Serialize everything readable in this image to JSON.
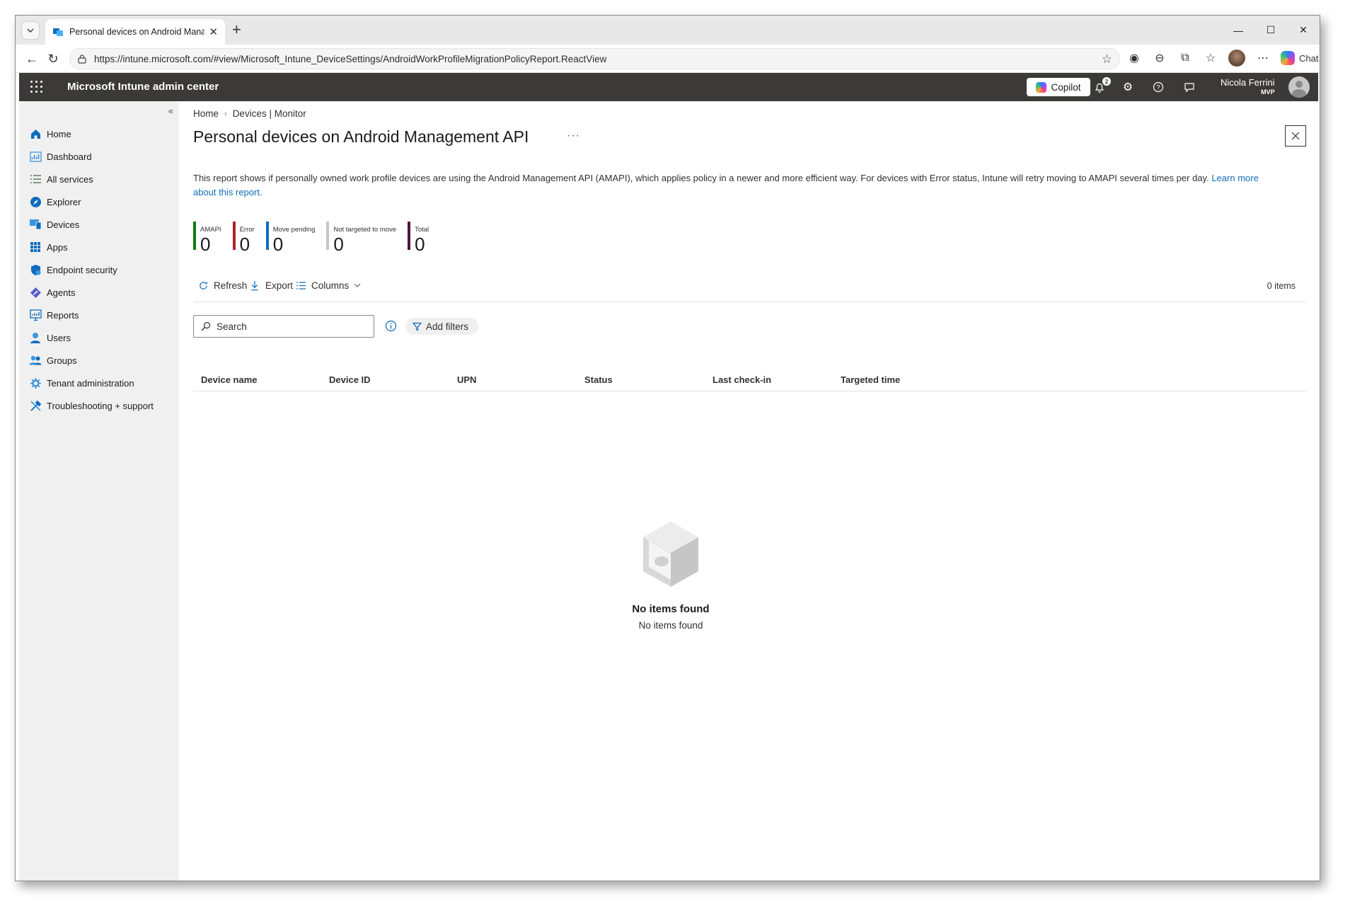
{
  "browser": {
    "tab_title": "Personal devices on Android Mana",
    "url": "https://intune.microsoft.com/#view/Microsoft_Intune_DeviceSettings/AndroidWorkProfileMigrationPolicyReport.ReactView",
    "chat_label": "Chat"
  },
  "portal": {
    "title": "Microsoft Intune admin center",
    "copilot_label": "Copilot",
    "notification_count": "2",
    "user_name": "Nicola Ferrini",
    "user_role": "MVP"
  },
  "nav": {
    "items": [
      {
        "label": "Home",
        "icon": "home-icon"
      },
      {
        "label": "Dashboard",
        "icon": "dashboard-icon"
      },
      {
        "label": "All services",
        "icon": "all-services-icon"
      },
      {
        "label": "Explorer",
        "icon": "explorer-icon"
      },
      {
        "label": "Devices",
        "icon": "devices-icon"
      },
      {
        "label": "Apps",
        "icon": "apps-icon"
      },
      {
        "label": "Endpoint security",
        "icon": "endpoint-security-icon"
      },
      {
        "label": "Agents",
        "icon": "agents-icon"
      },
      {
        "label": "Reports",
        "icon": "reports-icon"
      },
      {
        "label": "Users",
        "icon": "users-icon"
      },
      {
        "label": "Groups",
        "icon": "groups-icon"
      },
      {
        "label": "Tenant administration",
        "icon": "tenant-administration-icon"
      },
      {
        "label": "Troubleshooting + support",
        "icon": "troubleshooting-icon"
      }
    ]
  },
  "page": {
    "breadcrumb": [
      "Home",
      "Devices | Monitor"
    ],
    "title": "Personal devices on Android Management API",
    "description": "This report shows if personally owned work profile devices are using the Android Management API (AMAPI), which applies policy in a newer and more efficient way. For devices with Error status, Intune will retry moving to AMAPI several times per day.",
    "learn_more": "Learn more about this report."
  },
  "summary": [
    {
      "label": "AMAPI",
      "value": "0",
      "color": "#107c10"
    },
    {
      "label": "Error",
      "value": "0",
      "color": "#a4262c"
    },
    {
      "label": "Move pending",
      "value": "0",
      "color": "#0f6cbd"
    },
    {
      "label": "Not targeted to move",
      "value": "0",
      "color": "#c8c6c4"
    },
    {
      "label": "Total",
      "value": "0",
      "color": "#4b1642"
    }
  ],
  "commands": {
    "refresh": "Refresh",
    "export": "Export",
    "columns": "Columns",
    "items_count": "0 items"
  },
  "filters": {
    "search_placeholder": "Search",
    "add_filters": "Add filters"
  },
  "table": {
    "columns": [
      "Device name",
      "Device ID",
      "UPN",
      "Status",
      "Last check-in",
      "Targeted time"
    ],
    "rows": []
  },
  "empty_state": {
    "title": "No items found",
    "subtitle": "No items found"
  }
}
